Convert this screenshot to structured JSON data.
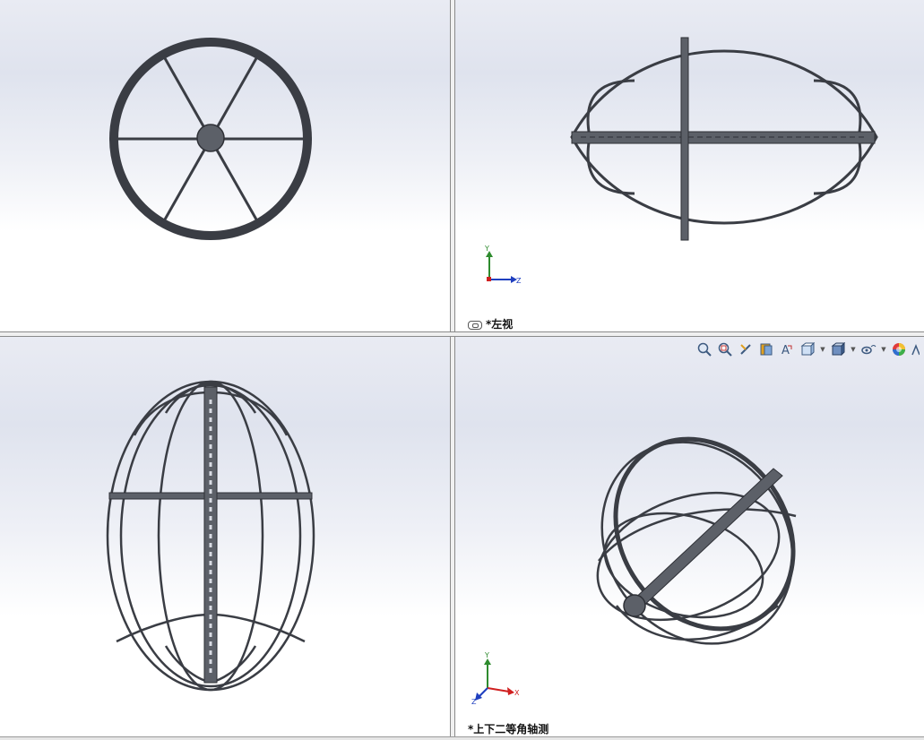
{
  "viewports": {
    "top_left": {
      "label": ""
    },
    "top_right": {
      "label": "*左视"
    },
    "bottom_left": {
      "label": ""
    },
    "bottom_right": {
      "label": "*上下二等角轴测"
    }
  },
  "triad": {
    "y": "Y",
    "z": "Z",
    "x": "X"
  },
  "toolbar": {
    "icons": [
      "zoom-to-fit-icon",
      "zoom-to-area-icon",
      "previous-view-icon",
      "section-view-icon",
      "dynamic-annotation-icon",
      "view-orientation-icon",
      "display-style-icon",
      "hide-show-items-icon",
      "edit-appearance-icon",
      "apply-scene-icon"
    ]
  },
  "colors": {
    "model_dark": "#3a3d44",
    "model_fill": "#5c6068",
    "triad_y": "#2e8b2e",
    "triad_z": "#1f3fbf",
    "triad_x": "#d02020"
  }
}
